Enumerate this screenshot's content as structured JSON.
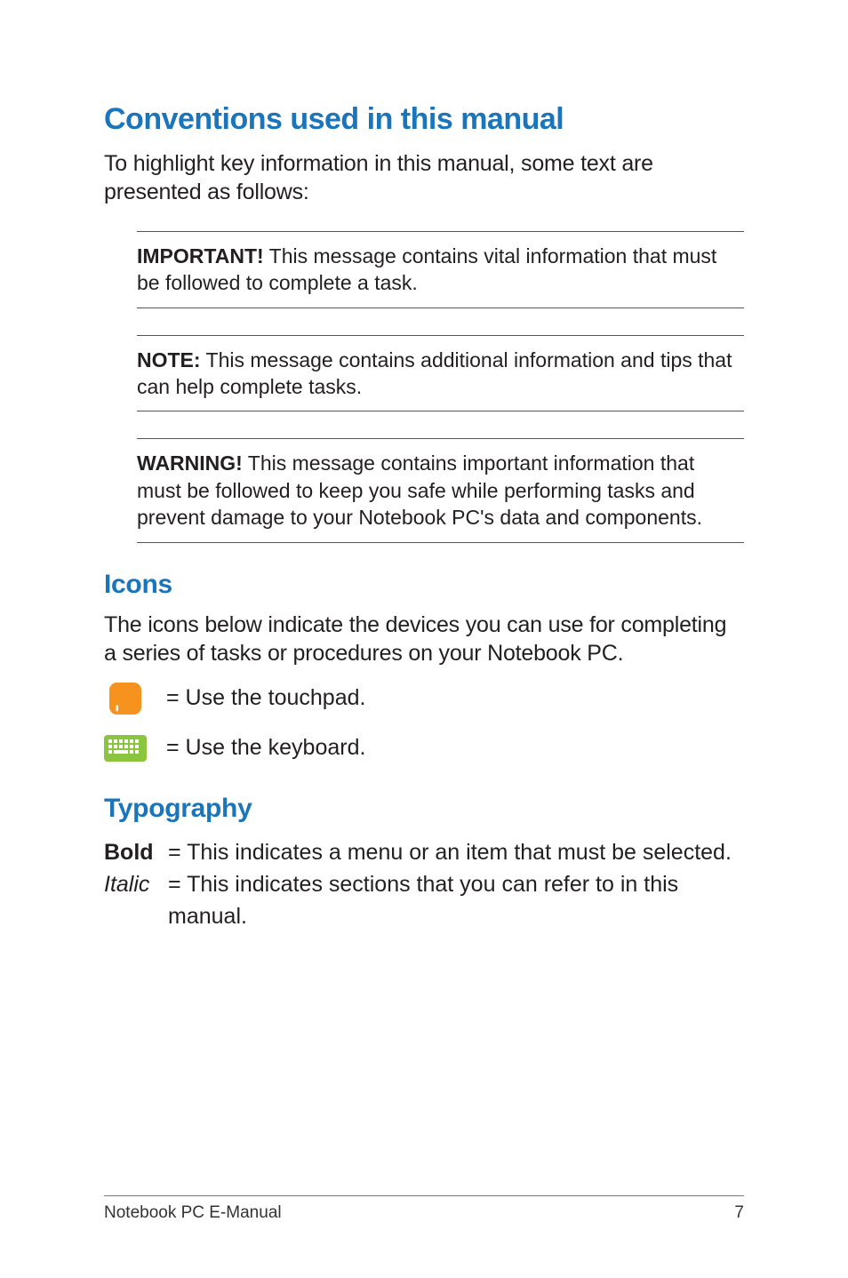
{
  "h_conventions": "Conventions used in this manual",
  "p_conventions": "To highlight key information in this manual, some text are presented as follows:",
  "callouts": {
    "important_label": "IMPORTANT!",
    "important_text": " This message contains vital information that must be followed to complete a task.",
    "note_label": "NOTE:",
    "note_text": " This message contains additional information and tips that can help complete tasks.",
    "warning_label": "WARNING!",
    "warning_text": " This message contains important information that must be followed to keep you safe while performing tasks and prevent damage to your Notebook PC's data and components."
  },
  "h_icons": "Icons",
  "p_icons": "The icons below indicate the devices you can use for completing a series of tasks or procedures on your Notebook PC.",
  "icon_rows": {
    "touchpad": "= Use the touchpad.",
    "keyboard": "= Use the keyboard."
  },
  "h_typography": "Typography",
  "typography": {
    "bold_label": "Bold",
    "bold_text": "= This indicates a menu or an item that must be selected.",
    "italic_label": "Italic",
    "italic_text": "= This indicates sections that you can refer to in this manual."
  },
  "footer_left": "Notebook PC E-Manual",
  "footer_right": "7"
}
